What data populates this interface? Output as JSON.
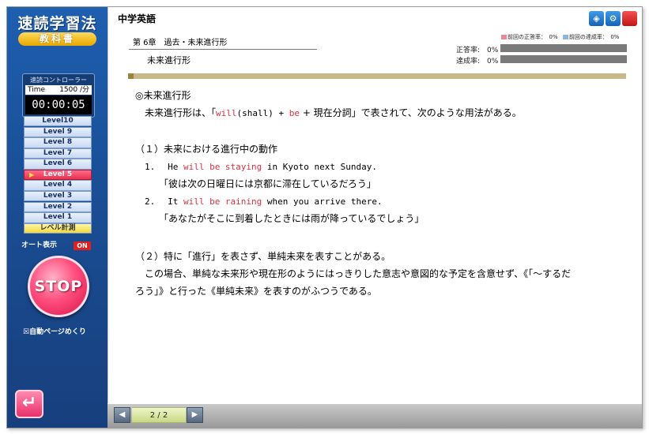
{
  "sidebar": {
    "brand": "速読学習法",
    "brand_sub": "教科書",
    "controller_title": "速読コントローラー",
    "time_label": "Time",
    "speed": "1500 /分",
    "timer": "00:00:05",
    "levels": [
      "Level10",
      "Level 9",
      "Level 8",
      "Level 7",
      "Level 6",
      "Level 5",
      "Level 4",
      "Level 3",
      "Level 2",
      "Level 1",
      "レベル計測"
    ],
    "active_level": "Level 5",
    "auto_display_label": "オート表示",
    "auto_display_state": "ON",
    "stop_label": "STOP",
    "auto_page_label": "☒自動ページめくり"
  },
  "header": {
    "subject": "中学英語",
    "chapter": "第 6章　過去・未来進行形",
    "section_title": "未来進行形",
    "legend_prev_correct": "前回の正答率：　0%",
    "legend_prev_completion": "前回の達成率：　0%",
    "correct_rate_label": "正答率:　0%",
    "completion_rate_label": "達成率:　0%"
  },
  "content": {
    "heading": "◎未来進行形",
    "intro_a": "未来進行形は、「",
    "intro_will": "will",
    "intro_b": "(shall) + ",
    "intro_be": "be",
    "intro_c": " + 現在分詞」で表されて、次のような用法がある。",
    "sec1": "（１）未来における進行中の動作",
    "ex1_num": "1.",
    "ex1_a": "He ",
    "ex1_red": "will be staying",
    "ex1_b": " in Kyoto next Sunday.",
    "ex1_jp": "「彼は次の日曜日には京都に滞在しているだろう」",
    "ex2_num": "2.",
    "ex2_a": "It ",
    "ex2_red": "will be raining",
    "ex2_b": " when you arrive there.",
    "ex2_jp": "「あなたがそこに到着したときには雨が降っているでしょう」",
    "sec2": "（２）特に「進行」を表さず、単純未来を表すことがある。",
    "sec2_p1": "この場合、単純な未来形や現在形のようにはっきりした意志や意図的な予定を含意せず、《「～するだ",
    "sec2_p2": "ろう」》と行った《単純未来》を表すのがふつうである。"
  },
  "footer": {
    "page_indicator": "2 / 2"
  },
  "icons": {
    "cube": "cube-icon",
    "settings": "gear-icon",
    "close": "close-icon",
    "prev": "prev-arrow-icon",
    "next": "next-arrow-icon",
    "back": "return-icon"
  }
}
